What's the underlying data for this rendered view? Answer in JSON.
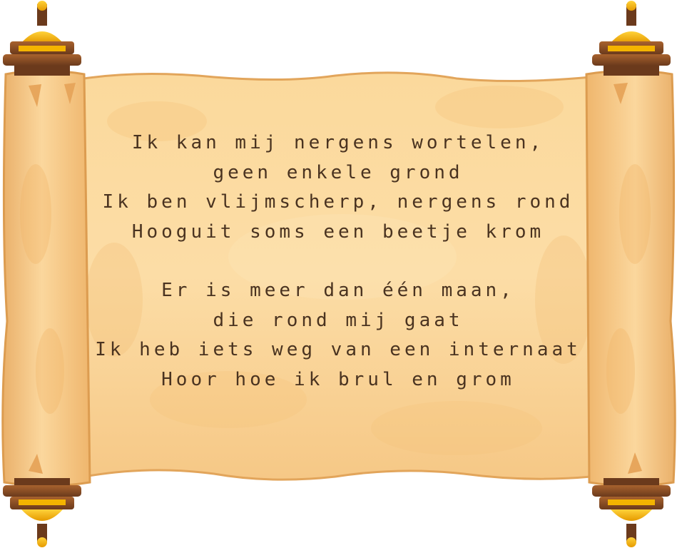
{
  "poem": {
    "stanzas": [
      {
        "lines": [
          "Ik kan mij nergens wortelen,",
          "geen enkele grond",
          "Ik ben vlijmscherp, nergens rond",
          "Hooguit soms een beetje krom"
        ]
      },
      {
        "lines": [
          "Er is meer dan één maan,",
          "die rond mij gaat",
          "Ik heb iets weg van een internaat",
          "Hoor hoe ik brul en grom"
        ]
      }
    ]
  },
  "colors": {
    "paper_light": "#fbdca4",
    "paper_mid": "#f5c47c",
    "paper_edge": "#e9a95a",
    "rod_wood_dark": "#6b3a1c",
    "rod_wood_mid": "#9c5a2a",
    "rod_gold": "#f4b400",
    "rod_gold_dark": "#d18a00",
    "ink": "#4a3320"
  },
  "decor": {
    "left_rod": "scroll-rod",
    "right_rod": "scroll-rod"
  }
}
